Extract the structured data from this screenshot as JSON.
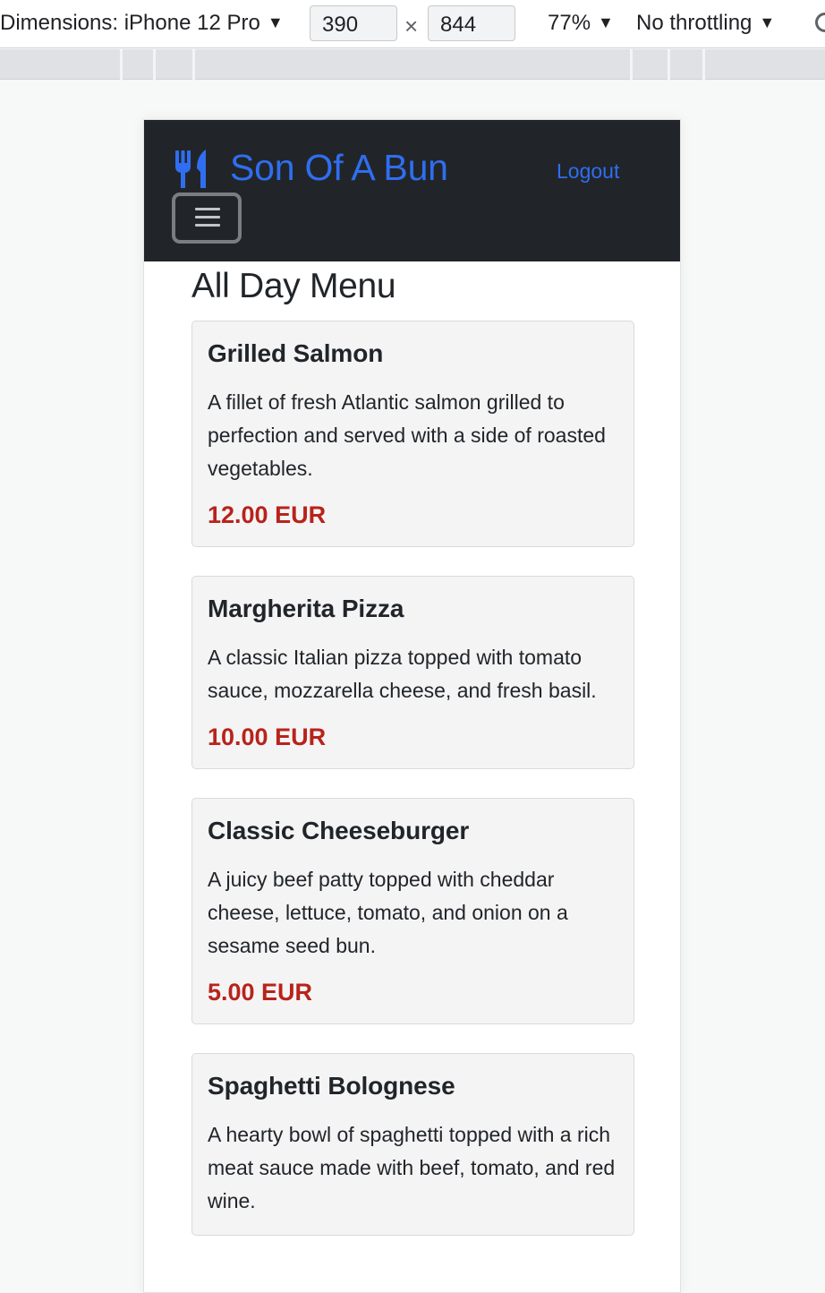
{
  "devtools": {
    "dimensions_label": "Dimensions: iPhone 12 Pro",
    "width": "390",
    "height": "844",
    "times": "×",
    "zoom": "77%",
    "throttling": "No throttling",
    "dropdown_arrow": "▼"
  },
  "navbar": {
    "brand": "Son Of A Bun",
    "brand_icon": "utensils-icon",
    "logout": "Logout",
    "toggler_icon": "hamburger-menu-icon",
    "background": "#212529",
    "link_color": "#2f6ef0"
  },
  "menu": {
    "title": "All Day Menu",
    "price_color": "#b8231a",
    "items": [
      {
        "name": "Grilled Salmon",
        "description": "A fillet of fresh Atlantic salmon grilled to perfection and served with a side of roasted vegetables.",
        "price": "12.00 EUR"
      },
      {
        "name": "Margherita Pizza",
        "description": "A classic Italian pizza topped with tomato sauce, mozzarella cheese, and fresh basil.",
        "price": "10.00 EUR"
      },
      {
        "name": "Classic Cheeseburger",
        "description": "A juicy beef patty topped with cheddar cheese, lettuce, tomato, and onion on a sesame seed bun.",
        "price": "5.00 EUR"
      },
      {
        "name": "Spaghetti Bolognese",
        "description": "A hearty bowl of spaghetti topped with a rich meat sauce made with beef, tomato, and red wine.",
        "price": ""
      }
    ]
  }
}
